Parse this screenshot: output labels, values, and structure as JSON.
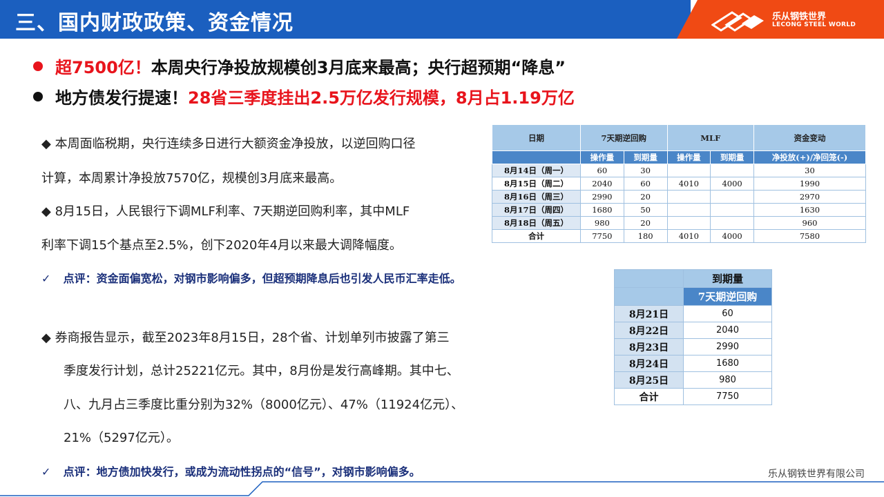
{
  "header": {
    "title": "三、国内财政政策、资金情况",
    "logo_cn": "乐从钢铁世界",
    "logo_en": "LECONG STEEL WORLD",
    "colors": {
      "blue": "#1b5fbf",
      "orange": "#f04a14"
    }
  },
  "headlines": [
    {
      "red": "超7500亿！",
      "black": "本周央行净投放规模创3月底来最高；央行超预期“降息”"
    },
    {
      "black": "地方债发行提速！",
      "red": "28省三季度挂出2.5万亿发行规模，8月占1.19万亿"
    }
  ],
  "paragraphs": {
    "p1_line1": "◆ 本周面临税期，央行连续多日进行大额资金净投放，以逆回购口径",
    "p1_line2": "计算，本周累计净投放7570亿，规模创3月底来最高。",
    "p2_line1": "◆  8月15日，人民银行下调MLF利率、7天期逆回购利率，其中MLF",
    "p2_line2": "利率下调15个基点至2.5%，创下2020年4月以来最大调降幅度。",
    "comment1": "点评：资金面偏宽松，对钢市影响偏多，但超预期降息后也引发人民币汇率走低。",
    "p3_line1": "◆   券商报告显示，截至2023年8月15日，28个省、计划单列市披露了第三",
    "p3_line2": "季度发行计划，总计25221亿元。其中，8月份是发行高峰期。其中七、",
    "p3_line3": "八、九月占三季度比重分别为32%（8000亿元）、47%（11924亿元）、",
    "p3_line4": "21%（5297亿元）。",
    "comment2": "点评：地方债加快发行，或成为流动性拐点的“信号”，对钢市影响偏多。",
    "check": "✓"
  },
  "table1": {
    "headers": {
      "date": "日期",
      "reverse_repo": "7天期逆回购",
      "mlf": "MLF",
      "funds": "资金变动"
    },
    "subheaders": {
      "op": "操作量",
      "due": "到期量",
      "op2": "操作量",
      "due2": "到期量",
      "net": "净投放(+)/净回笼(-)"
    },
    "rows": [
      {
        "date": "8月14日（周一）",
        "rr_op": "60",
        "rr_due": "30",
        "mlf_op": "",
        "mlf_due": "",
        "net": "30"
      },
      {
        "date": "8月15日（周二）",
        "rr_op": "2040",
        "rr_due": "60",
        "mlf_op": "4010",
        "mlf_due": "4000",
        "net": "1990"
      },
      {
        "date": "8月16日（周三）",
        "rr_op": "2990",
        "rr_due": "20",
        "mlf_op": "",
        "mlf_due": "",
        "net": "2970"
      },
      {
        "date": "8月17日（周四）",
        "rr_op": "1680",
        "rr_due": "50",
        "mlf_op": "",
        "mlf_due": "",
        "net": "1630"
      },
      {
        "date": "8月18日（周五）",
        "rr_op": "980",
        "rr_due": "20",
        "mlf_op": "",
        "mlf_due": "",
        "net": "960"
      },
      {
        "date": "合计",
        "rr_op": "7750",
        "rr_due": "180",
        "mlf_op": "4010",
        "mlf_due": "4000",
        "net": "7580"
      }
    ]
  },
  "table2": {
    "header": "到期量",
    "subheader": "7天期逆回购",
    "rows": [
      {
        "date": "8月21日",
        "value": "60"
      },
      {
        "date": "8月22日",
        "value": "2040"
      },
      {
        "date": "8月23日",
        "value": "2990"
      },
      {
        "date": "8月24日",
        "value": "1680"
      },
      {
        "date": "8月25日",
        "value": "980"
      },
      {
        "date": "合计",
        "value": "7750"
      }
    ]
  },
  "footer": "乐从钢铁世界有限公司"
}
